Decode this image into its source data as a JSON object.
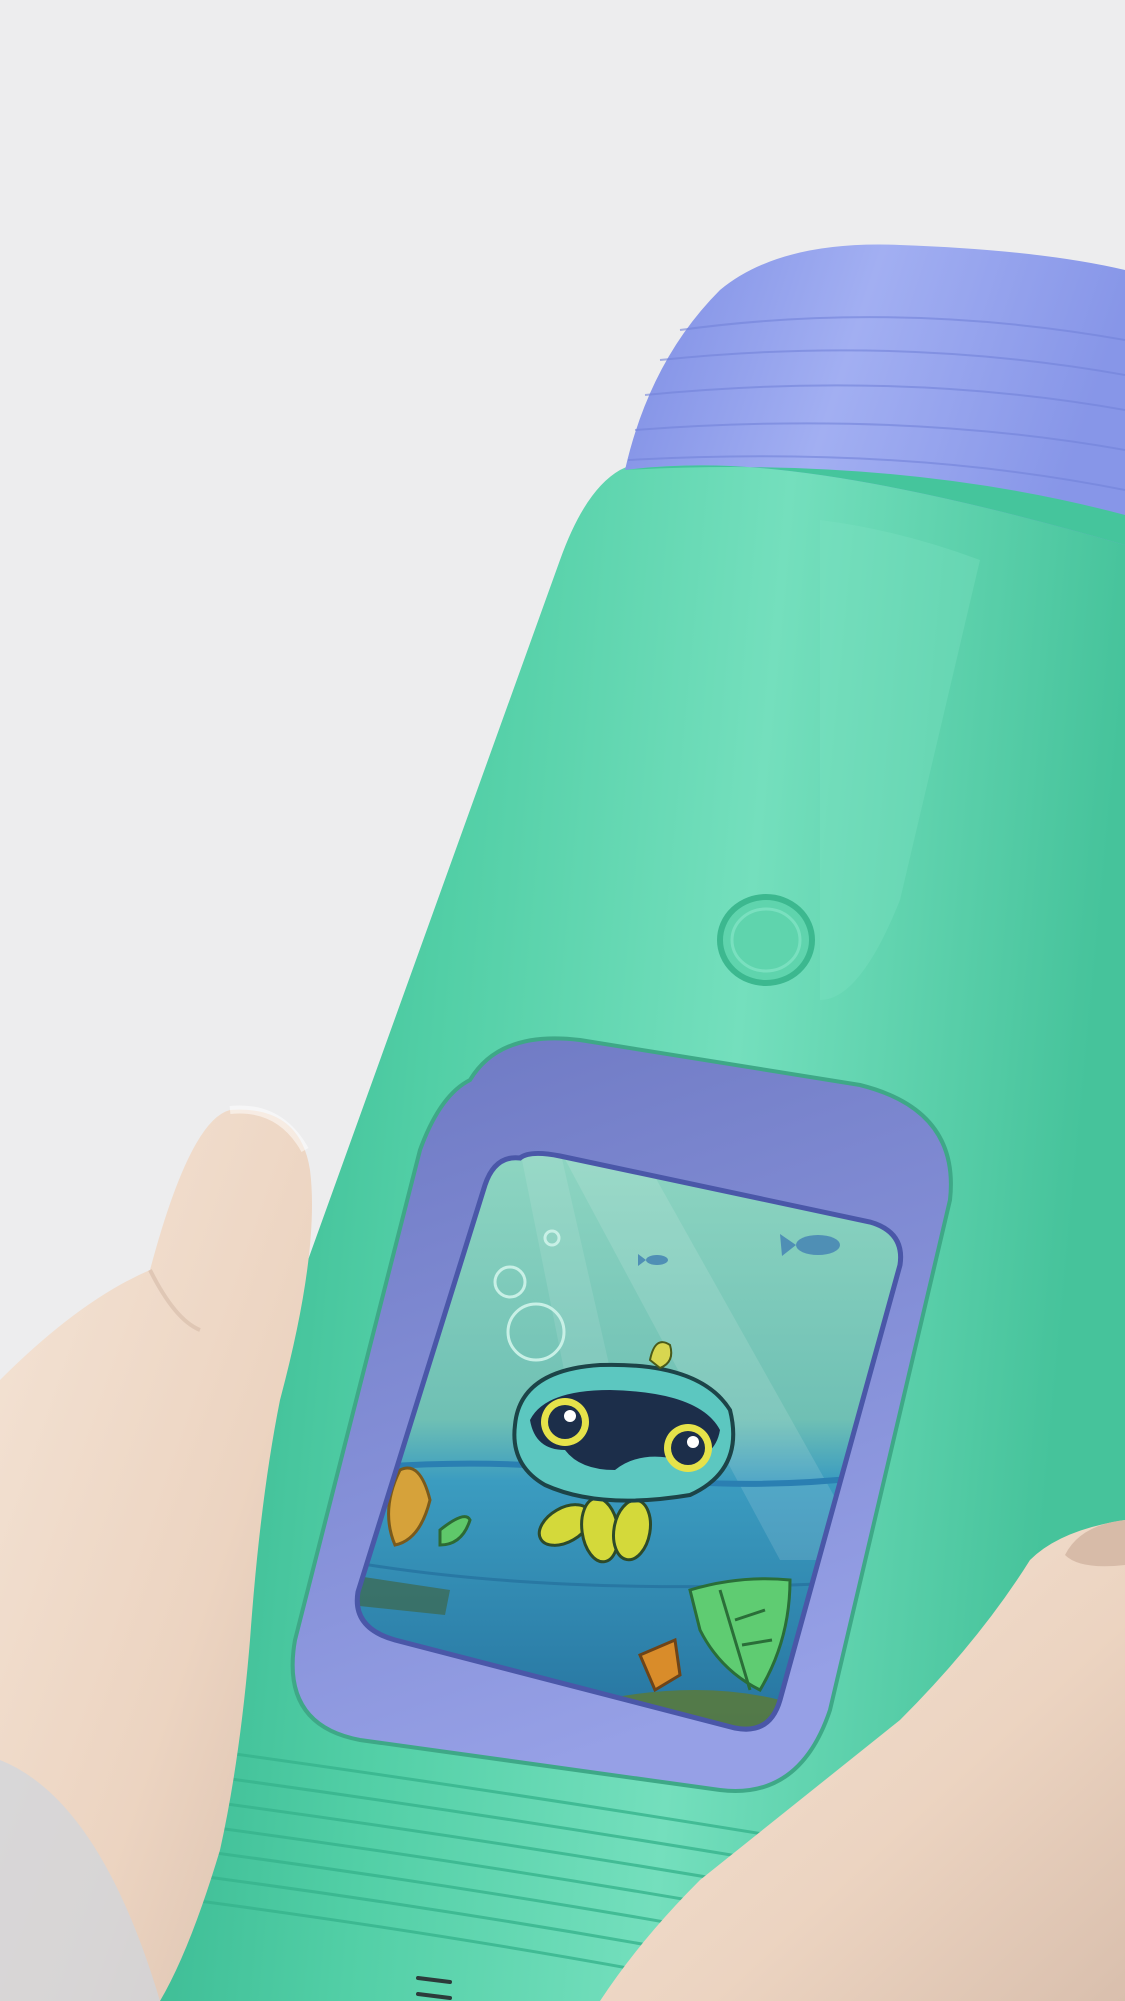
{
  "scene": {
    "subject": "smart-water-bottle",
    "colors": {
      "background": "#ededee",
      "bottle_body": "#52cfa6",
      "bottle_body_highlight": "#74dfbd",
      "bottle_body_shadow": "#2fb08a",
      "cap": "#8796e8",
      "cap_highlight": "#a2aff2",
      "screen_bezel": "#8590d8",
      "screen_bezel_dark": "#6d78c2",
      "water": "#2a86b8",
      "water_light": "#4fa8c8",
      "creature_body": "#5cc7c0",
      "creature_mask": "#1c2e4a",
      "creature_eye": "#e6e24a",
      "tentacles": "#d4d93a",
      "hand_skin": "#efd9c7",
      "hand_shadow": "#d9bfad"
    }
  }
}
